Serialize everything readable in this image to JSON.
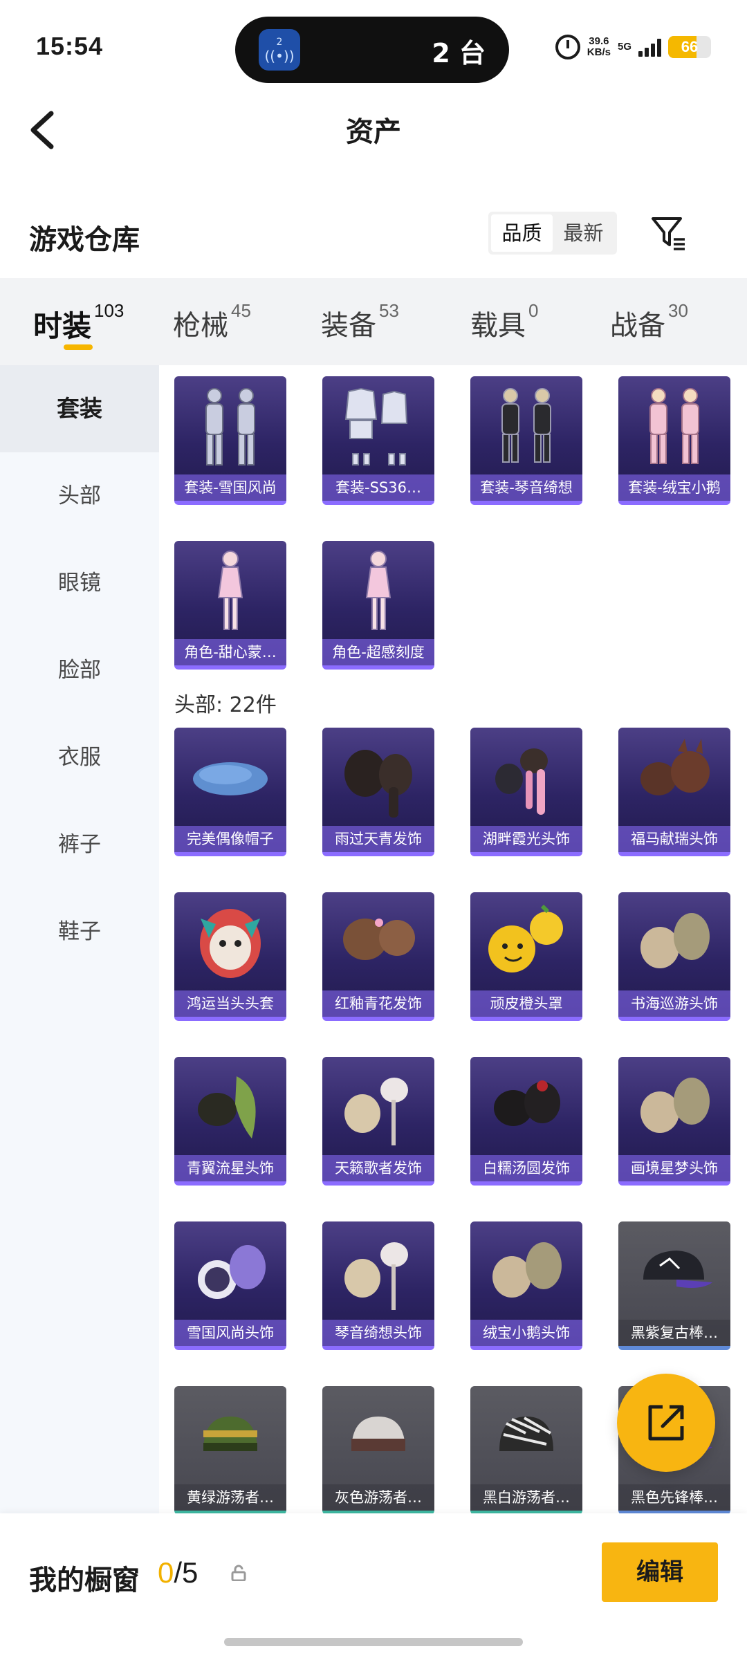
{
  "status_bar": {
    "time": "15:54",
    "island_badge": "2",
    "island_count": "2 台",
    "speed_value": "39.6",
    "speed_unit": "KB/s",
    "network": "5G",
    "battery_level": "66",
    "battery_percent": 66,
    "accent_color": "#f5b800"
  },
  "header": {
    "title": "资产",
    "back_icon": "chevron-left-icon"
  },
  "warehouse": {
    "title": "游戏仓库",
    "sort_options": [
      "品质",
      "最新"
    ],
    "sort_selected": "品质",
    "filter_icon": "filter-icon"
  },
  "tabs": [
    {
      "label": "时装",
      "count": "103",
      "active": true
    },
    {
      "label": "枪械",
      "count": "45",
      "active": false
    },
    {
      "label": "装备",
      "count": "53",
      "active": false
    },
    {
      "label": "载具",
      "count": "0",
      "active": false
    },
    {
      "label": "战备",
      "count": "30",
      "active": false
    }
  ],
  "side_menu": [
    {
      "label": "套装",
      "active": true
    },
    {
      "label": "头部",
      "active": false
    },
    {
      "label": "眼镜",
      "active": false
    },
    {
      "label": "脸部",
      "active": false
    },
    {
      "label": "衣服",
      "active": false
    },
    {
      "label": "裤子",
      "active": false
    },
    {
      "label": "鞋子",
      "active": false
    }
  ],
  "sets_group": {
    "items": [
      {
        "label": "套装-雪国风尚",
        "art": "outfit-suit"
      },
      {
        "label": "套装-SS36…",
        "art": "outfit-clothes"
      },
      {
        "label": "套装-琴音绮想",
        "art": "outfit-suit-dark"
      },
      {
        "label": "套装-绒宝小鹅",
        "art": "outfit-pink"
      },
      {
        "label": "角色-甜心蒙…",
        "art": "character"
      },
      {
        "label": "角色-超感刻度",
        "art": "character"
      }
    ]
  },
  "head_group": {
    "heading": "头部: 22件",
    "items": [
      {
        "label": "完美偶像帽子",
        "art": "beret",
        "tone": "purple"
      },
      {
        "label": "雨过天青发饰",
        "art": "hair-dark",
        "tone": "purple"
      },
      {
        "label": "湖畔霞光头饰",
        "art": "hair-pink",
        "tone": "purple"
      },
      {
        "label": "福马献瑞头饰",
        "art": "hair-horse",
        "tone": "purple"
      },
      {
        "label": "鸿运当头头套",
        "art": "lion-mask",
        "tone": "purple"
      },
      {
        "label": "红釉青花发饰",
        "art": "hair-brown",
        "tone": "purple"
      },
      {
        "label": "顽皮橙头罩",
        "art": "orange-head",
        "tone": "purple"
      },
      {
        "label": "书海巡游头饰",
        "art": "hair-blonde",
        "tone": "purple"
      },
      {
        "label": "青翼流星头饰",
        "art": "hair-green",
        "tone": "purple"
      },
      {
        "label": "天籁歌者发饰",
        "art": "hair-light",
        "tone": "purple"
      },
      {
        "label": "白糯汤圆发饰",
        "art": "hair-black",
        "tone": "purple"
      },
      {
        "label": "画境星梦头饰",
        "art": "hair-blonde",
        "tone": "purple"
      },
      {
        "label": "雪国风尚头饰",
        "art": "hood-purple",
        "tone": "purple"
      },
      {
        "label": "琴音绮想头饰",
        "art": "hair-light",
        "tone": "purple"
      },
      {
        "label": "绒宝小鹅头饰",
        "art": "hair-blonde",
        "tone": "purple"
      },
      {
        "label": "黑紫复古棒…",
        "art": "cap",
        "tone": "gray"
      },
      {
        "label": "黄绿游荡者…",
        "art": "beanie-green",
        "tone": "gray-teal"
      },
      {
        "label": "灰色游荡者…",
        "art": "beanie-gray",
        "tone": "gray-teal"
      },
      {
        "label": "黑白游荡者…",
        "art": "beanie-zebra",
        "tone": "gray-teal"
      },
      {
        "label": "黑色先锋棒…",
        "art": "cap",
        "tone": "gray"
      }
    ]
  },
  "fab": {
    "icon": "share-out-icon"
  },
  "bottom_bar": {
    "label": "我的橱窗",
    "current": "0",
    "total": "/5",
    "lock_icon": "lock-icon",
    "edit_label": "编辑",
    "accent_color": "#f8b511"
  }
}
